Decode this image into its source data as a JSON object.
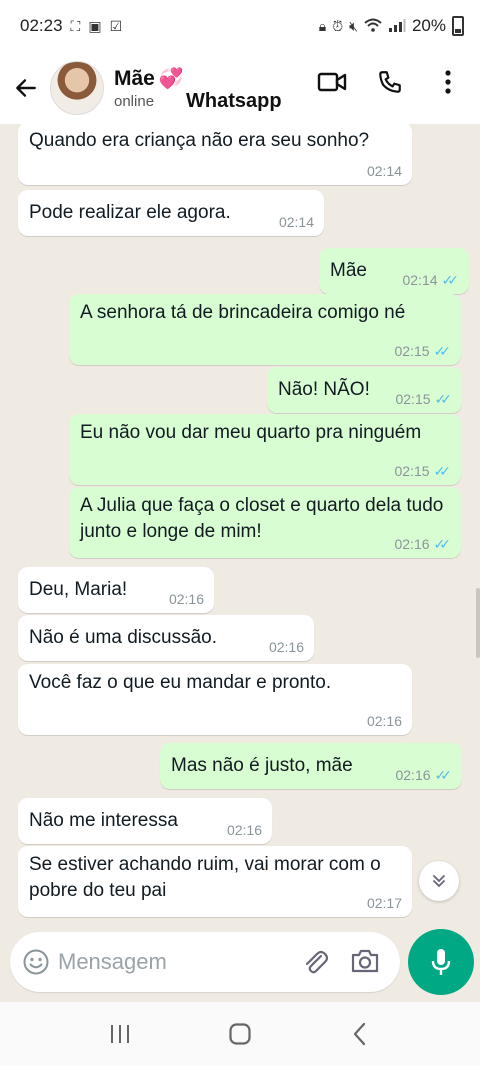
{
  "status_bar": {
    "time": "02:23",
    "battery": "20%"
  },
  "header": {
    "contact_name": "Mãe",
    "contact_emoji": "💞",
    "contact_status": "online",
    "overlay_title": "Whatsapp"
  },
  "messages": [
    {
      "dir": "in",
      "text": "Quando era criança não era seu sonho?",
      "time": "02:14"
    },
    {
      "dir": "in",
      "text": "Pode realizar ele agora.",
      "time": "02:14"
    },
    {
      "dir": "out",
      "text": "Mãe",
      "time": "02:14"
    },
    {
      "dir": "out",
      "text": "A senhora tá de brincadeira comigo né",
      "time": "02:15"
    },
    {
      "dir": "out",
      "text": "Não! NÃO!",
      "time": "02:15"
    },
    {
      "dir": "out",
      "text": "Eu não vou dar meu quarto pra ninguém",
      "time": "02:15"
    },
    {
      "dir": "out",
      "text": "A Julia que faça o closet e quarto dela tudo junto e longe de mim!",
      "time": "02:16"
    },
    {
      "dir": "in",
      "text": "Deu, Maria!",
      "time": "02:16"
    },
    {
      "dir": "in",
      "text": "Não é uma discussão.",
      "time": "02:16"
    },
    {
      "dir": "in",
      "text": "Você faz o que eu mandar e pronto.",
      "time": "02:16"
    },
    {
      "dir": "out",
      "text": "Mas não é justo, mãe",
      "time": "02:16"
    },
    {
      "dir": "in",
      "text": "Não me interessa",
      "time": "02:16"
    },
    {
      "dir": "in",
      "text": "Se estiver achando ruim, vai morar com o pobre do teu pai",
      "time": "02:17"
    }
  ],
  "composer": {
    "placeholder": "Mensagem"
  },
  "colors": {
    "accent": "#00a884",
    "outgoing_bubble": "#d9fdd3",
    "incoming_bubble": "#ffffff",
    "chat_bg": "#efeae2",
    "read_ticks": "#53bdeb"
  }
}
